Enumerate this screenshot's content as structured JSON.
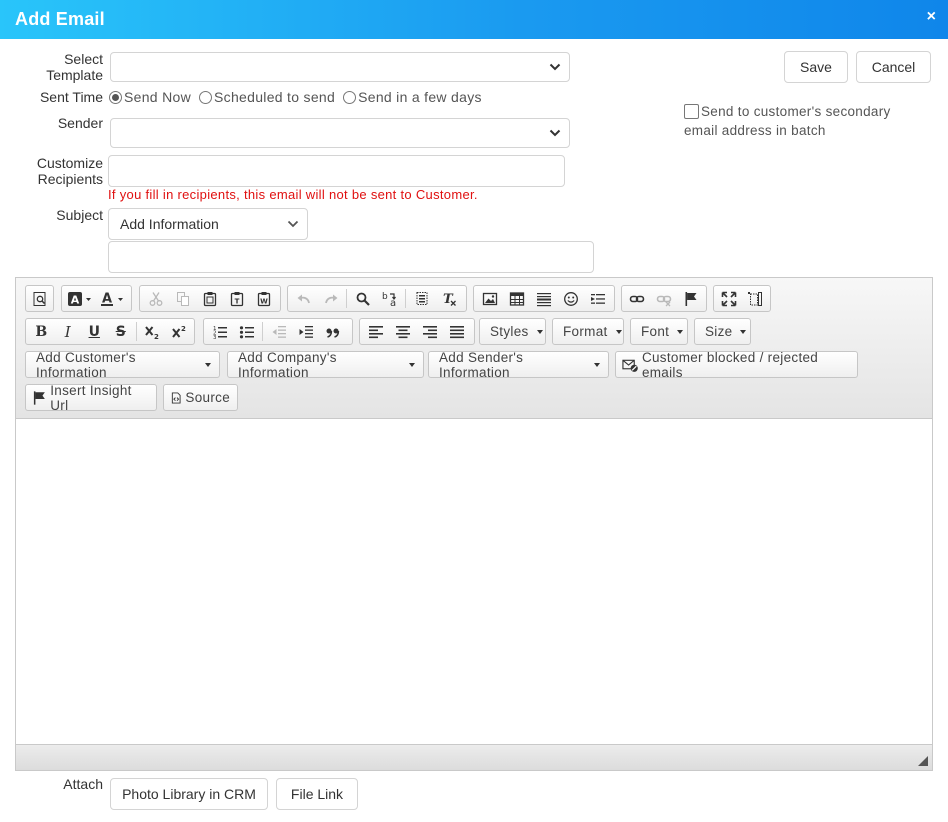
{
  "dialog": {
    "title": "Add Email",
    "close_glyph": "×"
  },
  "form": {
    "select_template_label_1": "Select",
    "select_template_label_2": "Template",
    "select_template_value": "",
    "sent_time_label": "Sent Time",
    "sent_time_options": [
      "Send Now",
      "Scheduled to send",
      "Send in a few days"
    ],
    "sent_time_selected": "Send Now",
    "sender_label": "Sender",
    "sender_value": "",
    "customize_label_1": "Customize",
    "customize_label_2": "Recipients",
    "recipients_value": "",
    "recipients_warning": "If you fill in recipients, this email will not be sent to Customer.",
    "subject_label": "Subject",
    "subject_add_info": "Add Information",
    "subject_value": "",
    "secondary_checkbox_label": "Send to customer's secondary email address in batch",
    "secondary_checked": false,
    "attach_label": "Attach"
  },
  "actions": {
    "save": "Save",
    "cancel": "Cancel",
    "photo_library": "Photo Library in CRM",
    "file_link": "File Link"
  },
  "editor": {
    "combos": {
      "styles": "Styles",
      "format": "Format",
      "font": "Font",
      "size": "Size"
    },
    "insert": {
      "customer_info": "Add Customer's Information",
      "company_info": "Add Company's Information",
      "sender_info": "Add Sender's Information",
      "blocked": "Customer blocked / rejected emails",
      "insight": "Insert Insight Url",
      "source": "Source"
    },
    "format_glyphs": {
      "bold": "B",
      "italic": "I",
      "underline": "U",
      "strike": "S"
    },
    "content": ""
  },
  "colors": {
    "title_gradient_start": "#29c5fa",
    "title_gradient_end": "#0f86ea",
    "warning": "#e01010"
  }
}
